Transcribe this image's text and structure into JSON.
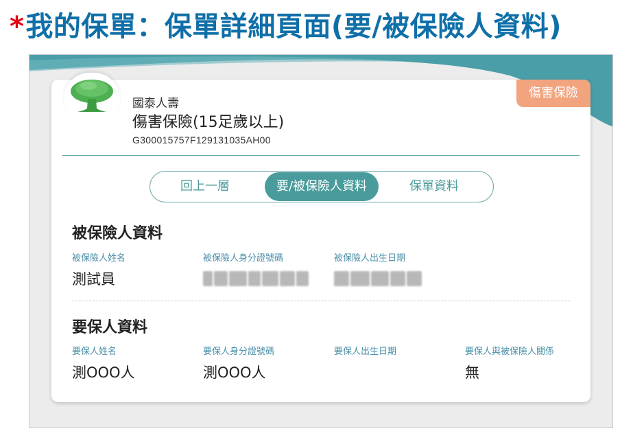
{
  "slide": {
    "star": "*",
    "title": "我的保單：保單詳細頁面(要/被保險人資料)"
  },
  "colors": {
    "title": "#0f6fa8",
    "star": "#e60012",
    "teal": "#4a9c9c",
    "badge": "#f2a47e",
    "label": "#4a8fa8"
  },
  "header": {
    "logo_icon": "tree-logo-icon",
    "company": "國泰人壽",
    "product": "傷害保險(15足歲以上)",
    "policy_number": "G300015757F129131035AH00",
    "badge": "傷害保險"
  },
  "tabs": {
    "back": "回上一層",
    "insured": "要/被保險人資料",
    "policy": "保單資料",
    "active": "insured"
  },
  "insured": {
    "title": "被保險人資料",
    "name_label": "被保險人姓名",
    "name_value": "測試員",
    "id_label": "被保險人身分證號碼",
    "birth_label": "被保險人出生日期"
  },
  "applicant": {
    "title": "要保人資料",
    "name_label": "要保人姓名",
    "name_value": "測OOO人",
    "id_label": "要保人身分證號碼",
    "id_value": "測OOO人",
    "birth_label": "要保人出生日期",
    "relation_label": "要保人與被保險人關係",
    "relation_value": "無"
  }
}
